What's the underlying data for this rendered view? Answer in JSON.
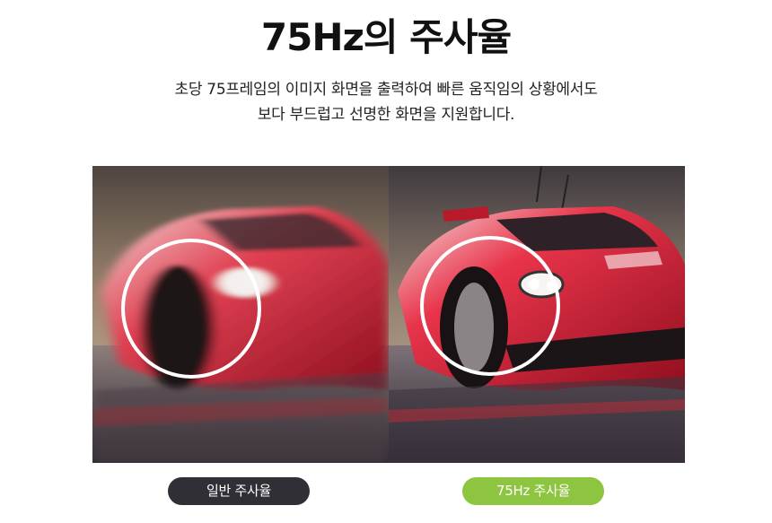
{
  "header": {
    "title": "75Hz의 주사율",
    "description_line1": "초당 75프레임의 이미지 화면을 출력하여 빠른 움직임의 상황에서도",
    "description_line2": "보다 부드럽고 선명한 화면을 지원합니다."
  },
  "comparison": {
    "left_label": "일반 주사율",
    "right_label": "75Hz 주사율",
    "left_badge_color": "#2f2f35",
    "right_badge_color": "#8dc540",
    "car_color": "#c8162c",
    "sky_color": "#6b5a4e"
  }
}
